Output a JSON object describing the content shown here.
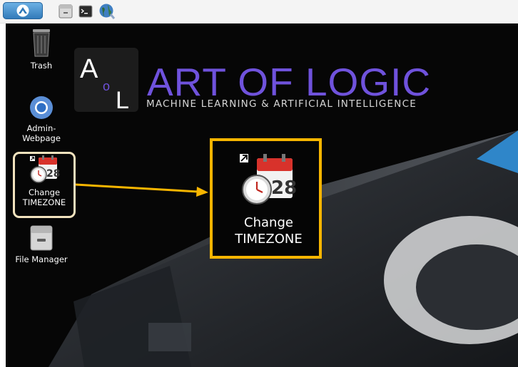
{
  "panel": {
    "menu_icon": "distro-logo-icon",
    "launchers": [
      "file-cabinet-icon",
      "terminal-icon",
      "web-browser-icon"
    ]
  },
  "branding": {
    "logo_letters": [
      "A",
      "o",
      "L"
    ],
    "title": "ART OF LOGIC",
    "subtitle": "MACHINE LEARNING & ARTIFICIAL INTELLIGENCE"
  },
  "desktop_icons": [
    {
      "label": "Trash",
      "icon": "trash-icon"
    },
    {
      "label_lines": [
        "Admin-",
        "Webpage"
      ],
      "icon": "chromium-icon"
    },
    {
      "label_lines": [
        "Change",
        "TIMEZONE"
      ],
      "icon": "calendar-clock-icon",
      "badge": "28"
    },
    {
      "label": "File Manager",
      "icon": "file-cabinet-icon"
    }
  ],
  "callout": {
    "label_lines": [
      "Change",
      "TIMEZONE"
    ],
    "badge": "28"
  },
  "colors": {
    "brand_purple": "#6f52dc",
    "highlight_orange": "#f7b500",
    "highlight_cream": "#f1e2bd",
    "arrow": "#f7b500"
  }
}
